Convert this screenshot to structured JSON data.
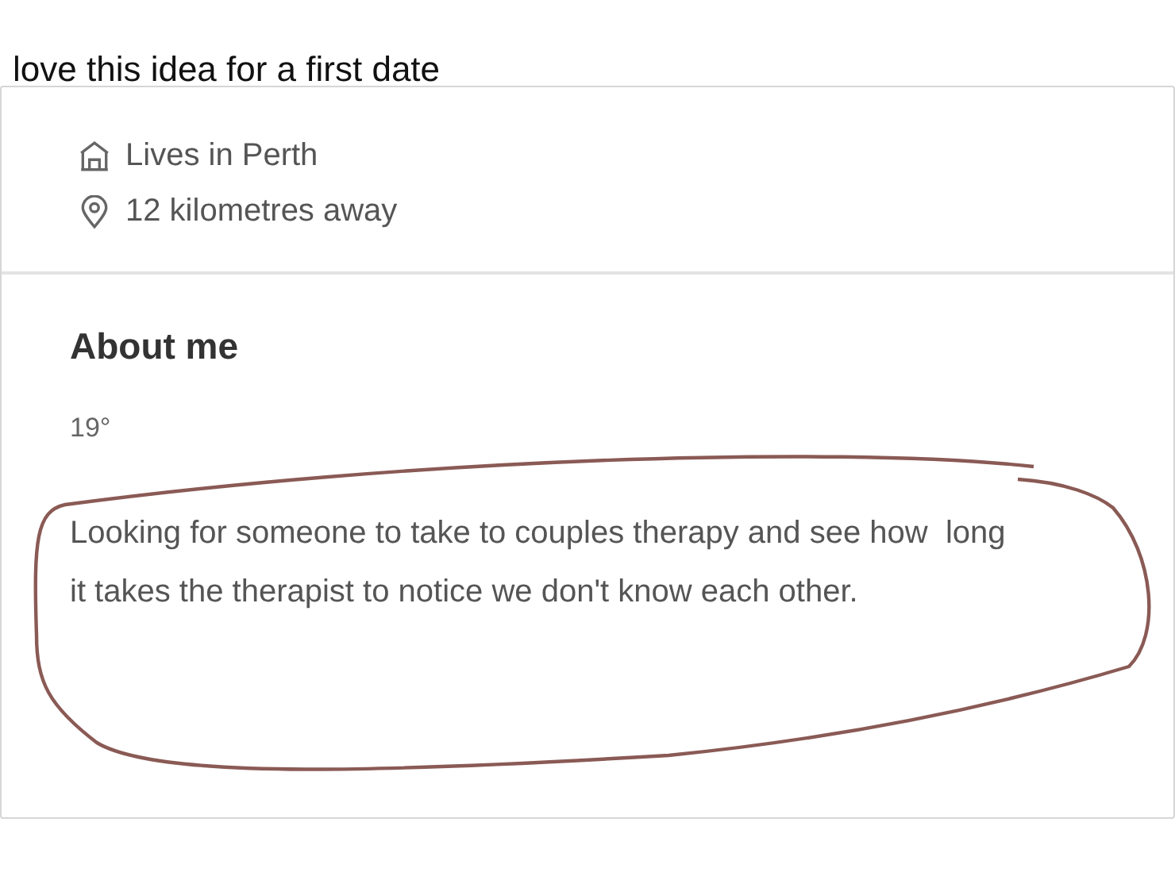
{
  "post": {
    "caption": "love this idea for a first date"
  },
  "profile": {
    "facts": [
      {
        "kind": "home",
        "text": "Lives in Perth"
      },
      {
        "kind": "distance",
        "text": "12 kilometres away"
      }
    ],
    "about_heading": "About me",
    "age": "19°",
    "bio": "Looking for someone to take to couples therapy and see how  long it takes the therapist to notice we don't know each other."
  }
}
